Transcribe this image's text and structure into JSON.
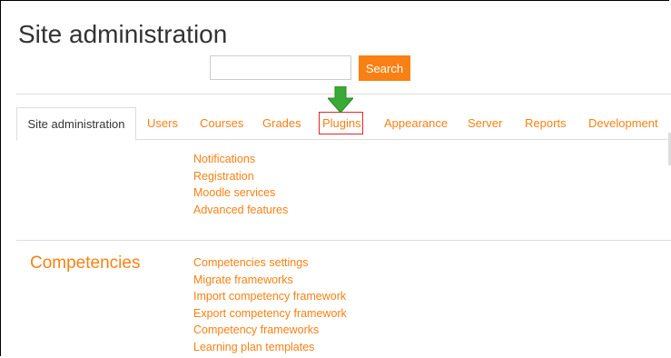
{
  "page_title": "Site administration",
  "search": {
    "value": "",
    "placeholder": "",
    "button_label": "Search"
  },
  "tabs": [
    {
      "label": "Site administration",
      "active": true
    },
    {
      "label": "Users"
    },
    {
      "label": "Courses"
    },
    {
      "label": "Grades"
    },
    {
      "label": "Plugins",
      "highlighted": true
    },
    {
      "label": "Appearance"
    },
    {
      "label": "Server"
    },
    {
      "label": "Reports"
    },
    {
      "label": "Development"
    }
  ],
  "general": {
    "links": [
      "Notifications",
      "Registration",
      "Moodle services",
      "Advanced features"
    ]
  },
  "competencies": {
    "heading": "Competencies",
    "links": [
      "Competencies settings",
      "Migrate frameworks",
      "Import competency framework",
      "Export competency framework",
      "Competency frameworks",
      "Learning plan templates"
    ]
  },
  "annotation": {
    "arrow_icon": "down-arrow-icon",
    "arrow_color": "#3aa935",
    "highlight_color": "#e0262b"
  },
  "colors": {
    "accent": "#f98012",
    "text": "#333333",
    "border": "#dddddd"
  }
}
